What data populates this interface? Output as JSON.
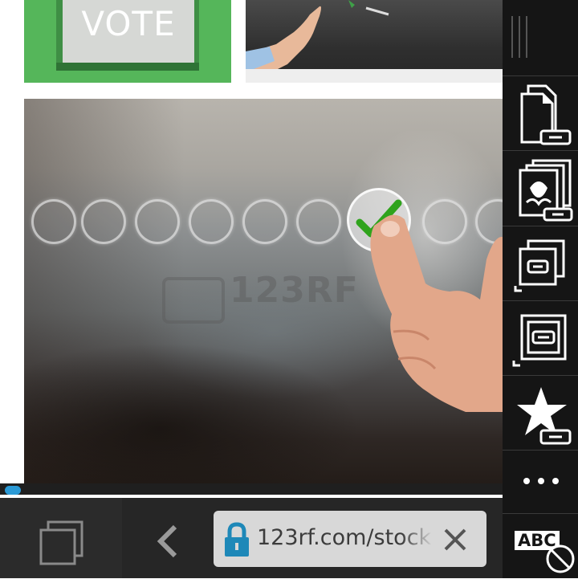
{
  "content": {
    "vote_tile": {
      "card_text": "VOTE"
    },
    "main_photo": {
      "watermark": "123RF"
    }
  },
  "progress": {
    "fraction": 0.02
  },
  "bottom_bar": {
    "url": "123rf.com/stock-",
    "icons": {
      "tabs": "tabs-icon",
      "back": "back-chevron-icon",
      "lock": "lock-icon",
      "clear": "close-icon"
    }
  },
  "sidebar": {
    "icons": [
      "drag-handle-icon",
      "share-page-link-icon",
      "share-image-link-icon",
      "copy-link-icon",
      "copy-link-alt-icon",
      "bookmark-link-icon",
      "more-icon"
    ],
    "abc_label": "ABC"
  },
  "colors": {
    "accent": "#2b9ad6",
    "vote_green": "#55b65a",
    "check_green": "#2fa31c",
    "bar_bg": "#262626",
    "sidebar_bg": "#151515"
  }
}
